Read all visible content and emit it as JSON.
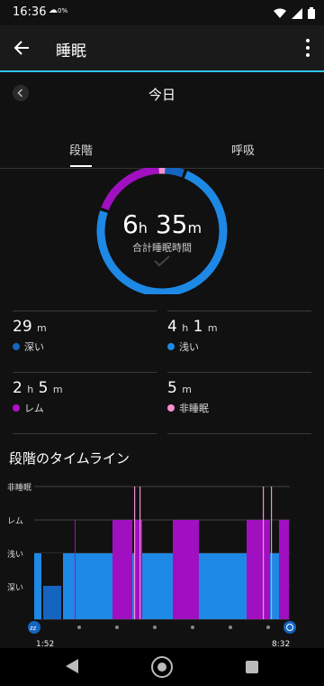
{
  "status": {
    "time": "16:36",
    "notif": "0%"
  },
  "app_bar": {
    "title": "睡眠"
  },
  "date": {
    "title": "今日"
  },
  "tabs": [
    {
      "label": "段階"
    },
    {
      "label": "呼吸"
    }
  ],
  "summary": {
    "hours": "6",
    "hours_unit": "h",
    "minutes": "35",
    "minutes_unit": "m",
    "label": "合計睡眠時間"
  },
  "stats": [
    {
      "value": "29",
      "unit_main": "m",
      "label": "深い",
      "color": "#1565c0"
    },
    {
      "value": "4",
      "unit_main": "h",
      "value2": "1",
      "unit2": "m",
      "label": "浅い",
      "color": "#1e88e5"
    },
    {
      "value": "2",
      "unit_main": "h",
      "value2": "5",
      "unit2": "m",
      "label": "レム",
      "color": "#b010c8"
    },
    {
      "value": "5",
      "unit_main": "m",
      "label": "非睡眠",
      "color": "#f48fd0"
    }
  ],
  "timeline": {
    "title": "段階のタイムライン",
    "levels": [
      "非睡眠",
      "レム",
      "浅い",
      "深い"
    ],
    "start": "1:52",
    "end": "8:32"
  },
  "colors": {
    "deep": "#1565c0",
    "light": "#1e88e5",
    "rem": "#a010c0",
    "awake": "#f48fd0",
    "accent": "#2ec4e6"
  }
}
